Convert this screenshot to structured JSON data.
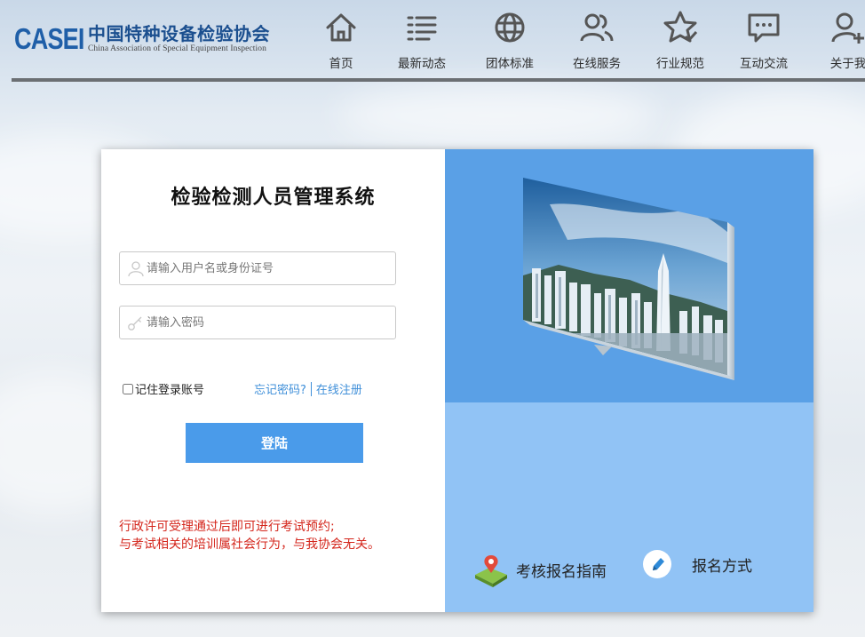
{
  "header": {
    "logo_abbr": "CASEI",
    "logo_cn": "中国特种设备检验协会",
    "logo_en": "China Association of Special Equipment Inspection"
  },
  "nav": [
    {
      "label": "首页",
      "icon": "home-icon"
    },
    {
      "label": "最新动态",
      "icon": "news-list-icon"
    },
    {
      "label": "团体标准",
      "icon": "globe-icon"
    },
    {
      "label": "在线服务",
      "icon": "users-icon"
    },
    {
      "label": "行业规范",
      "icon": "star-check-icon"
    },
    {
      "label": "互动交流",
      "icon": "chat-icon"
    },
    {
      "label": "关于我",
      "icon": "user-add-icon"
    }
  ],
  "login": {
    "title": "检验检测人员管理系统",
    "username_placeholder": "请输入用户名或身份证号",
    "password_placeholder": "请输入密码",
    "remember_label": "记住登录账号",
    "forgot_label": "忘记密码?",
    "register_label": "在线注册",
    "submit_label": "登陆"
  },
  "notice": {
    "line1": "行政许可受理通过后即可进行考试预约;",
    "line2": "与考试相关的培训属社会行为，与我协会无关。"
  },
  "guides": {
    "exam_guide_label": "考核报名指南",
    "signup_method_label": "报名方式"
  },
  "colors": {
    "brand_blue": "#1f5fa8",
    "button_blue": "#4a9bea",
    "link_blue": "#3f8fd9",
    "notice_red": "#d4261c",
    "panel_top": "#5aa0e6",
    "panel_bottom": "#91c3f5"
  }
}
